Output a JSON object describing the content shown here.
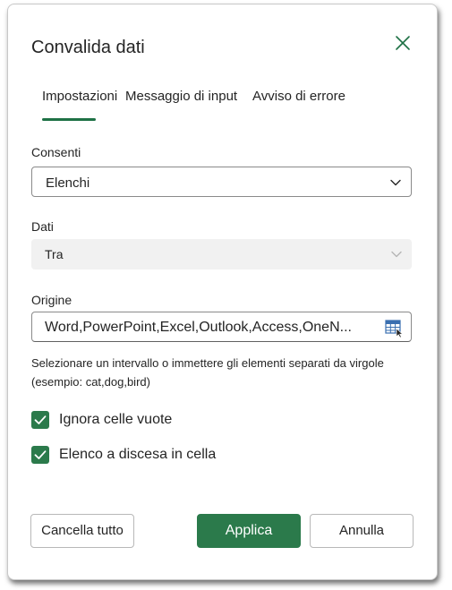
{
  "dialog": {
    "title": "Convalida dati"
  },
  "tabs": [
    {
      "label": "Impostazioni",
      "selected": true
    },
    {
      "label": "Messaggio di input",
      "selected": false
    },
    {
      "label": "Avviso di errore",
      "selected": false
    }
  ],
  "allow": {
    "label": "Consenti",
    "value": "Elenchi"
  },
  "data": {
    "label": "Dati",
    "value": "Tra",
    "disabled": true
  },
  "source": {
    "label": "Origine",
    "value": "Word,PowerPoint,Excel,Outlook,Access,OneN...",
    "help": "Selezionare un intervallo o immettere gli elementi separati da virgole (esempio: cat,dog,bird)"
  },
  "options": [
    {
      "label": "Ignora celle vuote",
      "checked": true
    },
    {
      "label": "Elenco a discesa in cella",
      "checked": true
    }
  ],
  "buttons": {
    "clear": "Cancella tutto",
    "apply": "Applica",
    "cancel": "Annulla"
  },
  "colors": {
    "accent": "#2b7a4b",
    "tab_underline": "#1e7145",
    "disabled_bg": "#f1f1f1"
  },
  "icons": {
    "close": "close-icon",
    "chevron": "chevron-down-icon",
    "range_picker": "range-picker-icon",
    "check": "checkmark-icon"
  }
}
